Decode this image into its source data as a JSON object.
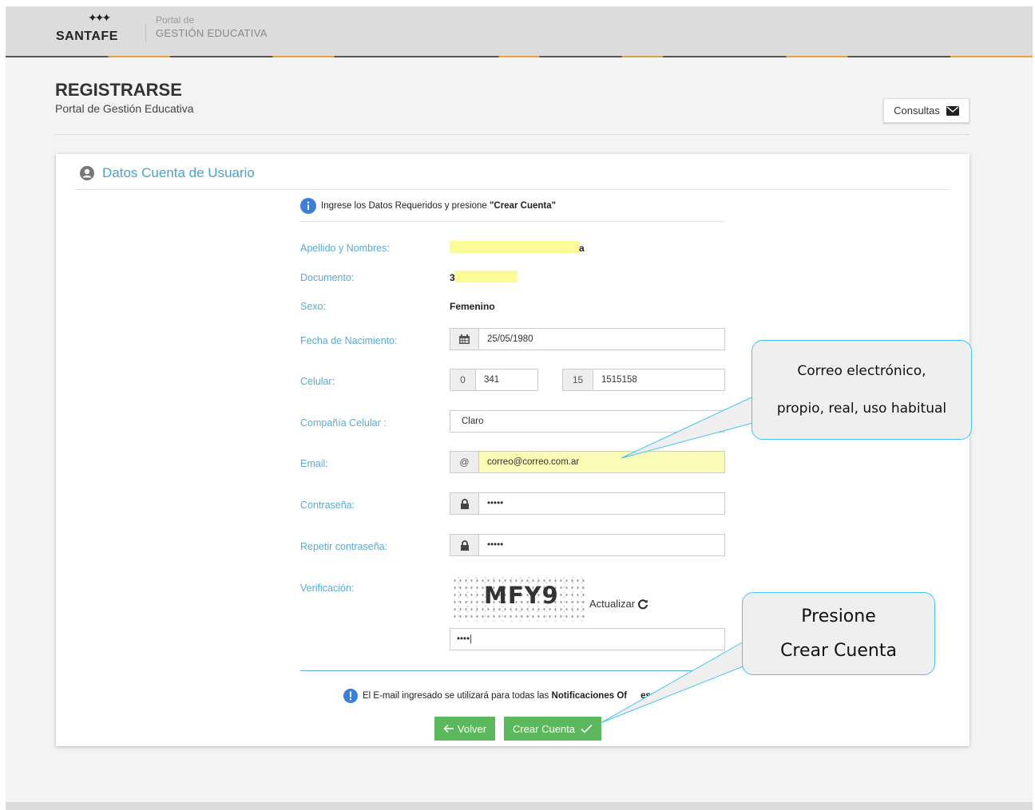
{
  "header": {
    "logo_stars": "✦✦✦",
    "logo_text": "SANTAFE",
    "portal_small": "Portal de",
    "portal_big": "GESTIÓN EDUCATIVA"
  },
  "page": {
    "title": "REGISTRARSE",
    "subtitle": "Portal de Gestión Educativa",
    "consultas_label": "Consultas"
  },
  "card": {
    "title": "Datos Cuenta de Usuario",
    "info_prefix": "Ingrese los Datos Requeridos y presione ",
    "info_bold": "\"Crear Cuenta\""
  },
  "form": {
    "apellido_label": "Apellido y Nombres:",
    "apellido_value_start": "",
    "apellido_value_end": "a",
    "documento_label": "Documento:",
    "documento_value": "3",
    "sexo_label": "Sexo:",
    "sexo_value": "Femenino",
    "fecha_label": "Fecha de Nacimiento:",
    "fecha_value": "25/05/1980",
    "celular_label": "Celular:",
    "celular_code_prefix": "0",
    "celular_code": "341",
    "celular_num_prefix": "15",
    "celular_num": "1515158",
    "compania_label": "Compañía Celular :",
    "compania_value": "Claro",
    "email_label": "Email:",
    "email_prefix": "@",
    "email_value": "correo@correo.com.ar",
    "password_label": "Contraseña:",
    "password_value": "•••••",
    "repeat_label": "Repetir contraseña:",
    "repeat_value": "•••••",
    "verif_label": "Verificación:",
    "captcha_text": "MFY9",
    "actualizar_label": "Actualizar",
    "verif_value": "••••|"
  },
  "notice": {
    "prefix": "El E-mail ingresado se utilizará para todas las ",
    "bold": "Notificaciones Of",
    "suffix": "es"
  },
  "buttons": {
    "volver": "Volver",
    "crear": "Crear Cuenta"
  },
  "callouts": {
    "email_line1": "Correo electrónico,",
    "email_line2": "propio, real, uso habitual",
    "crear_line1": "Presione",
    "crear_line2": "Crear Cuenta"
  },
  "colors": {
    "accent": "#4aa3c9",
    "button_green": "#5cb85c",
    "highlight": "#fbfb98",
    "callout_border": "#43c6ea"
  }
}
